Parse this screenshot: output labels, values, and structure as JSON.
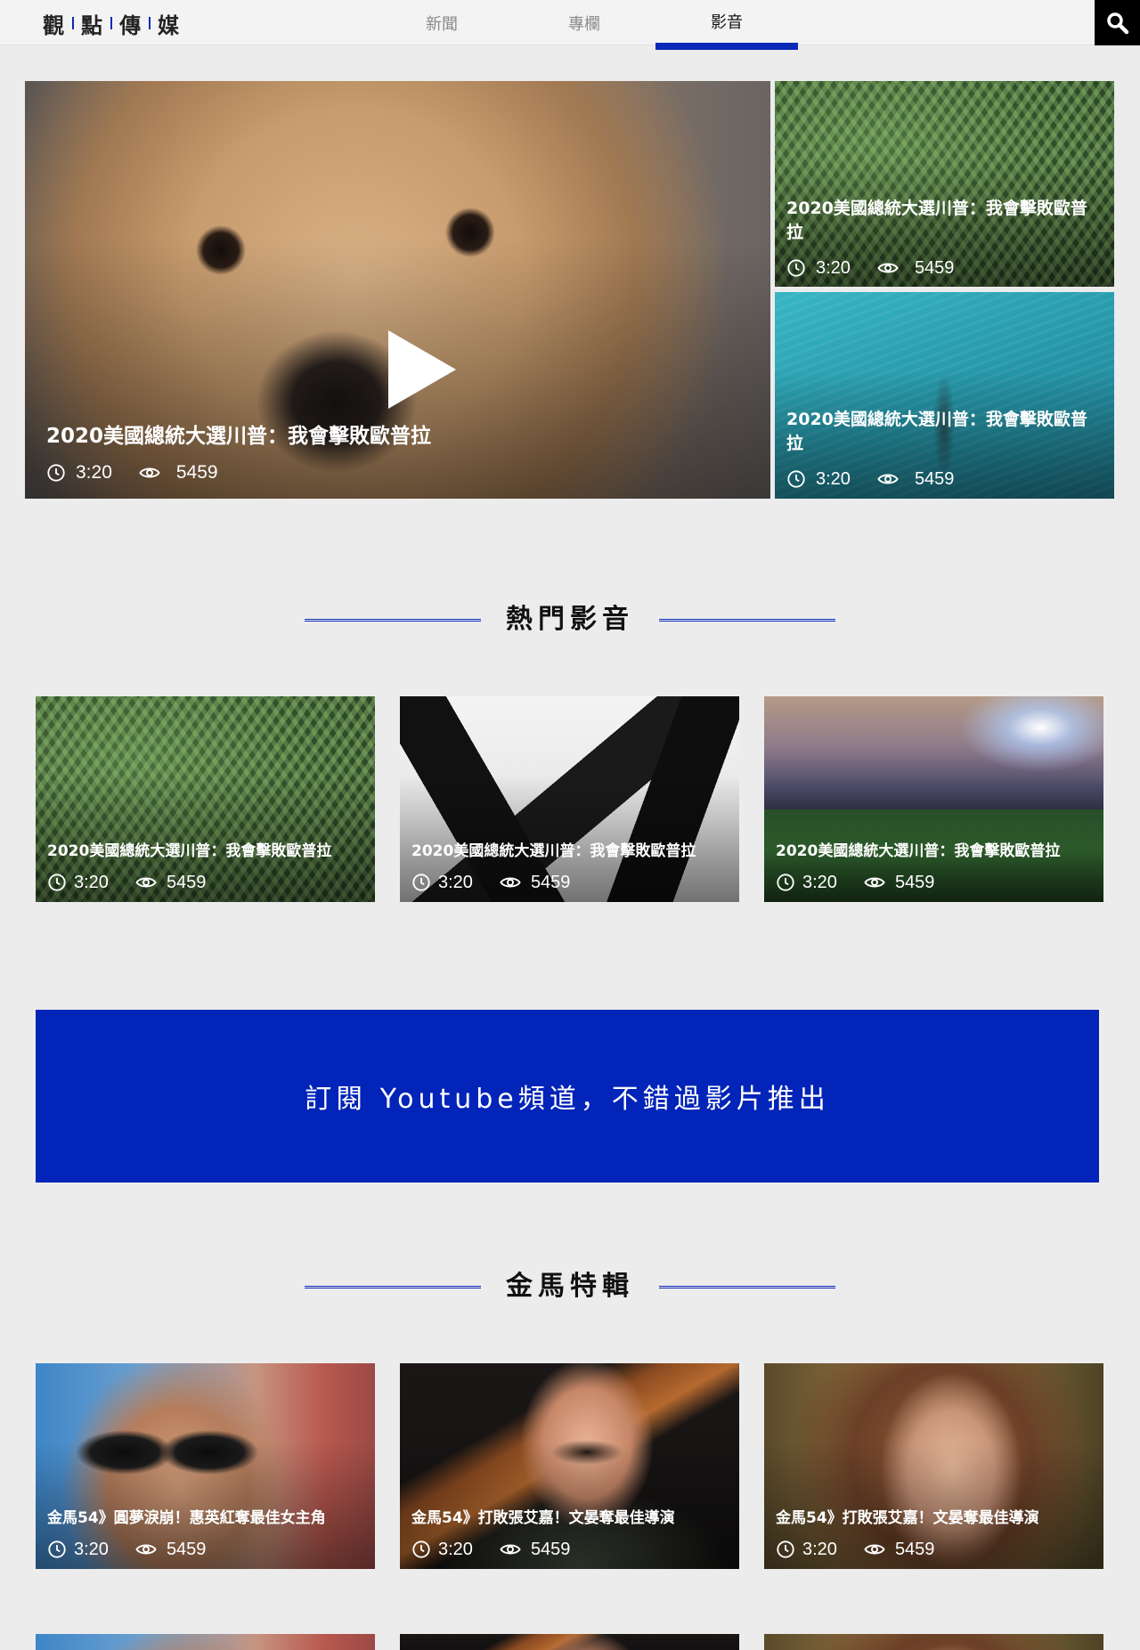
{
  "header": {
    "logo_chars": [
      "觀",
      "點",
      "傳",
      "媒"
    ],
    "tabs": [
      {
        "label": "新聞",
        "active": false
      },
      {
        "label": "專欄",
        "active": false
      },
      {
        "label": "影音",
        "active": true
      }
    ],
    "search_icon": "search-icon"
  },
  "featured": {
    "main": {
      "title": "2020美國總統大選川普：我會擊敗歐普拉",
      "duration": "3:20",
      "views": "5459",
      "image": "golden retriever close-up"
    },
    "side": [
      {
        "title": "2020美國總統大選川普：我會擊敗歐普拉",
        "duration": "3:20",
        "views": "5459",
        "image": "fern leaves"
      },
      {
        "title": "2020美國總統大選川普：我會擊敗歐普拉",
        "duration": "3:20",
        "views": "5459",
        "image": "aerial ocean"
      }
    ]
  },
  "hot_videos": {
    "heading": "熱門影音",
    "items": [
      {
        "title": "2020美國總統大選川普：我會擊敗歐普拉",
        "duration": "3:20",
        "views": "5459",
        "image": "fern leaves"
      },
      {
        "title": "2020美國總統大選川普：我會擊敗歐普拉",
        "duration": "3:20",
        "views": "5459",
        "image": "smartphones"
      },
      {
        "title": "2020美國總統大選川普：我會擊敗歐普拉",
        "duration": "3:20",
        "views": "5459",
        "image": "baseball stadium at night"
      }
    ]
  },
  "subscribe_banner": {
    "text": "訂閱 Youtube頻道，不錯過影片推出"
  },
  "golden_horse": {
    "heading": "金馬特輯",
    "items": [
      {
        "title": "金馬54》圓夢淚崩！惠英紅奪最佳女主角",
        "duration": "3:20",
        "views": "5459",
        "image": "smiling man with sunglasses"
      },
      {
        "title": "金馬54》打敗張艾嘉！文晏奪最佳導演",
        "duration": "3:20",
        "views": "5459",
        "image": "man with guitar and glasses"
      },
      {
        "title": "金馬54》打敗張艾嘉！文晏奪最佳導演",
        "duration": "3:20",
        "views": "5459",
        "image": "woman with windblown hair"
      }
    ]
  },
  "colors": {
    "accent": "#0a29b8",
    "banner": "#0324b8",
    "page_bg": "#ececec",
    "header_bg": "#f3f3f3"
  }
}
